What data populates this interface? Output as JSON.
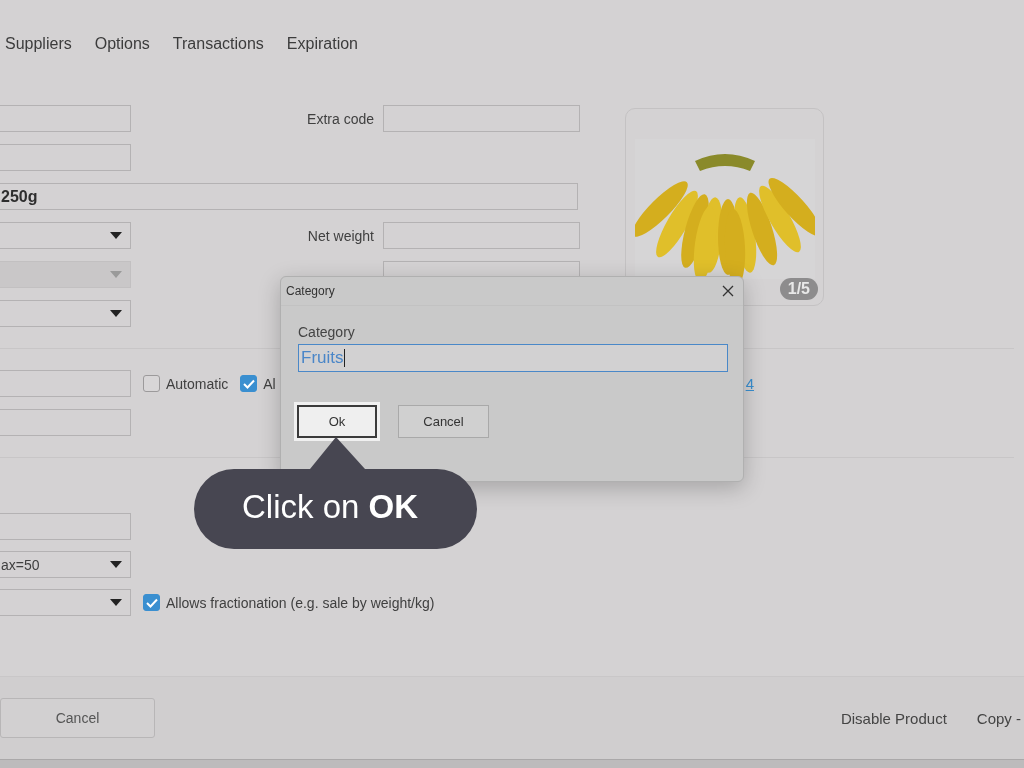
{
  "tabs": [
    {
      "label": "Suppliers"
    },
    {
      "label": "Options"
    },
    {
      "label": "Transactions"
    },
    {
      "label": "Expiration"
    }
  ],
  "fields_top": [
    {
      "kind": "text",
      "disabled": false,
      "right_label": "Extra code"
    },
    {
      "kind": "text",
      "disabled": false
    },
    {
      "kind": "wide",
      "disabled": false,
      "value": "250g"
    },
    {
      "kind": "select",
      "disabled": false,
      "right_label": "Net weight"
    },
    {
      "kind": "select",
      "disabled": true,
      "right_field": true
    },
    {
      "kind": "select",
      "disabled": false
    }
  ],
  "fields_middle": [
    {
      "kind": "text",
      "checkboxes": [
        {
          "label": "Automatic",
          "checked": false
        },
        {
          "label": "Al",
          "checked": true
        }
      ],
      "link": "4"
    },
    {
      "kind": "text"
    }
  ],
  "fields_bottom": [
    {
      "kind": "text"
    },
    {
      "kind": "select",
      "value": "ax=50"
    },
    {
      "kind": "select",
      "checkboxes": [
        {
          "label": "Allows fractionation (e.g. sale by weight/kg)",
          "checked": true
        }
      ]
    }
  ],
  "image": {
    "kind": "picture",
    "counter": "1/5"
  },
  "footer": {
    "buttons": [
      "Cancel"
    ],
    "actions": [
      "Disable Product",
      "Copy -"
    ]
  },
  "dialog": {
    "title": "Category",
    "field_label": "Category",
    "value": "Fruits",
    "buttons": [
      {
        "label": "Ok",
        "focused": true
      },
      {
        "label": "Cancel",
        "focused": false
      }
    ]
  },
  "callout": {
    "text": "Click on **OK**"
  }
}
